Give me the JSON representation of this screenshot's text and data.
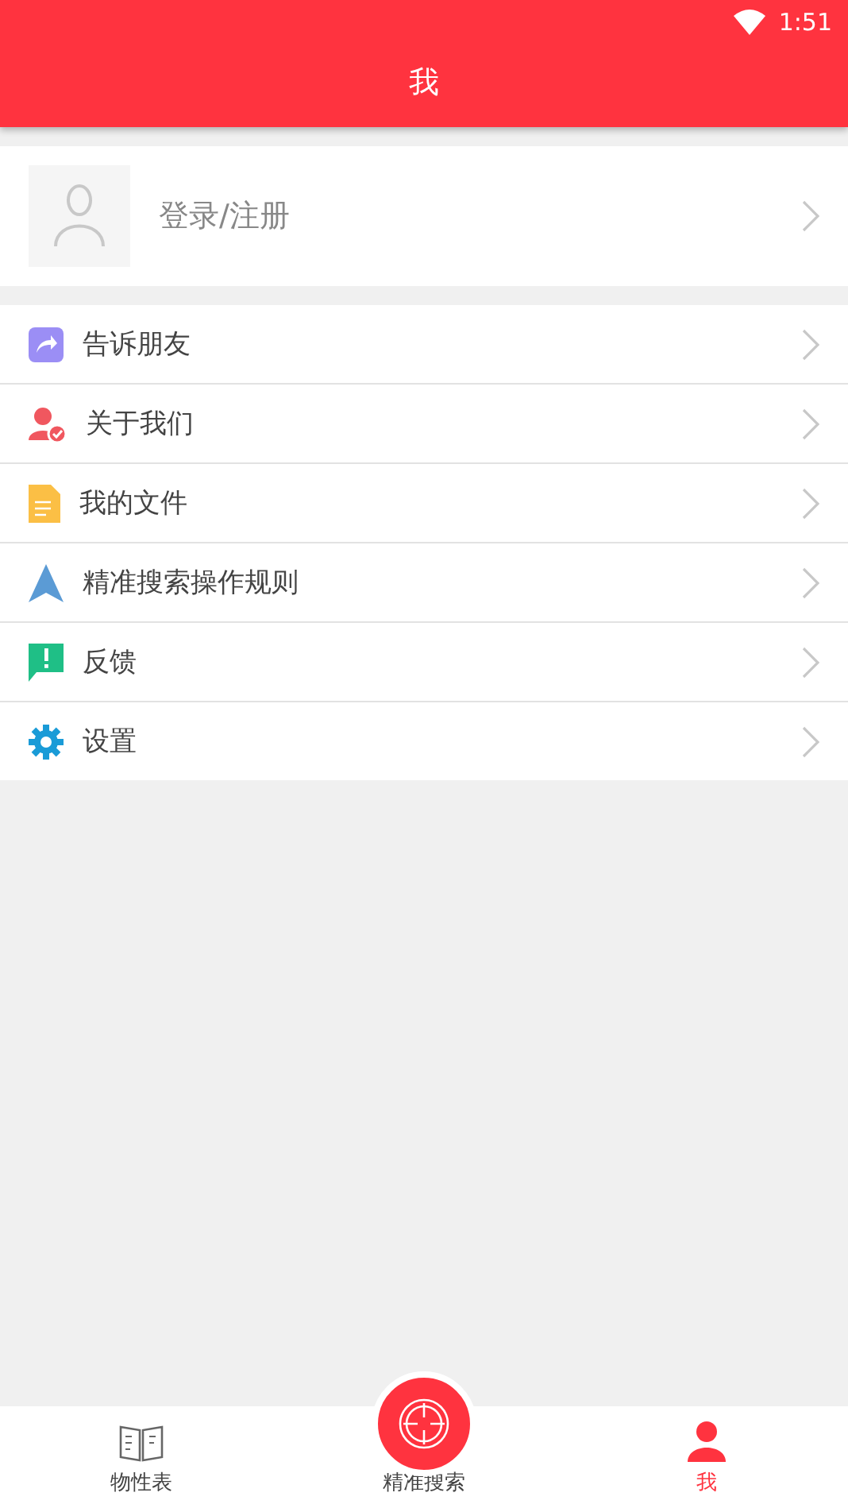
{
  "status_bar": {
    "time": "1:51"
  },
  "header": {
    "title": "我"
  },
  "login": {
    "label": "登录/注册"
  },
  "menu": [
    {
      "kind": "share",
      "label": "告诉朋友"
    },
    {
      "kind": "about",
      "label": "关于我们"
    },
    {
      "kind": "file",
      "label": "我的文件"
    },
    {
      "kind": "navigate",
      "label": "精准搜索操作规则"
    },
    {
      "kind": "feedback",
      "label": "反馈"
    },
    {
      "kind": "settings",
      "label": "设置"
    }
  ],
  "tabs": [
    {
      "kind": "book",
      "label": "物性表",
      "selected": false
    },
    {
      "kind": "target",
      "label": "精准搜索",
      "selected": false
    },
    {
      "kind": "person",
      "label": "我",
      "selected": true
    }
  ]
}
